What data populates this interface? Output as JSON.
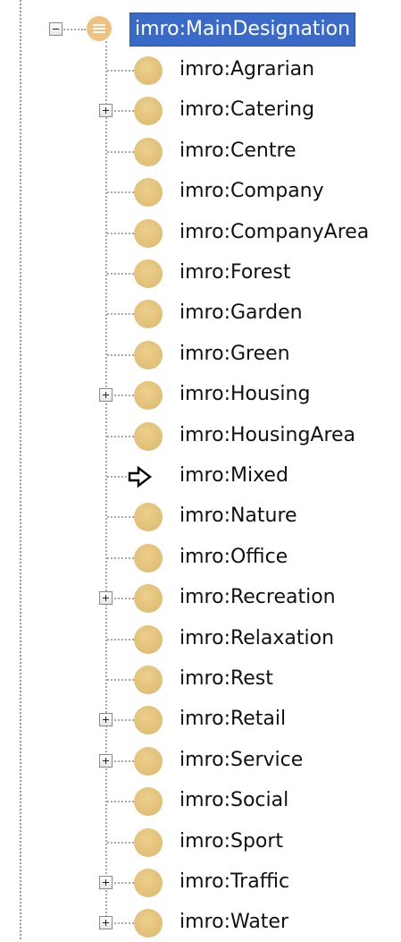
{
  "tree": {
    "root": {
      "label": "imro:MainDesignation"
    },
    "items": [
      {
        "label": "imro:Agrarian",
        "expandable": false
      },
      {
        "label": "imro:Catering",
        "expandable": true
      },
      {
        "label": "imro:Centre",
        "expandable": false
      },
      {
        "label": "imro:Company",
        "expandable": false
      },
      {
        "label": "imro:CompanyArea",
        "expandable": false
      },
      {
        "label": "imro:Forest",
        "expandable": false
      },
      {
        "label": "imro:Garden",
        "expandable": false
      },
      {
        "label": "imro:Green",
        "expandable": false
      },
      {
        "label": "imro:Housing",
        "expandable": true
      },
      {
        "label": "imro:HousingArea",
        "expandable": false
      },
      {
        "label": "imro:Mixed",
        "expandable": false,
        "icon": "arrow-cursor-icon"
      },
      {
        "label": "imro:Nature",
        "expandable": false
      },
      {
        "label": "imro:Office",
        "expandable": false
      },
      {
        "label": "imro:Recreation",
        "expandable": true
      },
      {
        "label": "imro:Relaxation",
        "expandable": false
      },
      {
        "label": "imro:Rest",
        "expandable": false
      },
      {
        "label": "imro:Retail",
        "expandable": true
      },
      {
        "label": "imro:Service",
        "expandable": true
      },
      {
        "label": "imro:Social",
        "expandable": false
      },
      {
        "label": "imro:Sport",
        "expandable": false
      },
      {
        "label": "imro:Traffic",
        "expandable": true
      },
      {
        "label": "imro:Water",
        "expandable": true
      }
    ]
  },
  "colors": {
    "selection_bg": "#3a6ac8",
    "class_icon": "#e2c078",
    "root_icon": "#f0c080"
  }
}
